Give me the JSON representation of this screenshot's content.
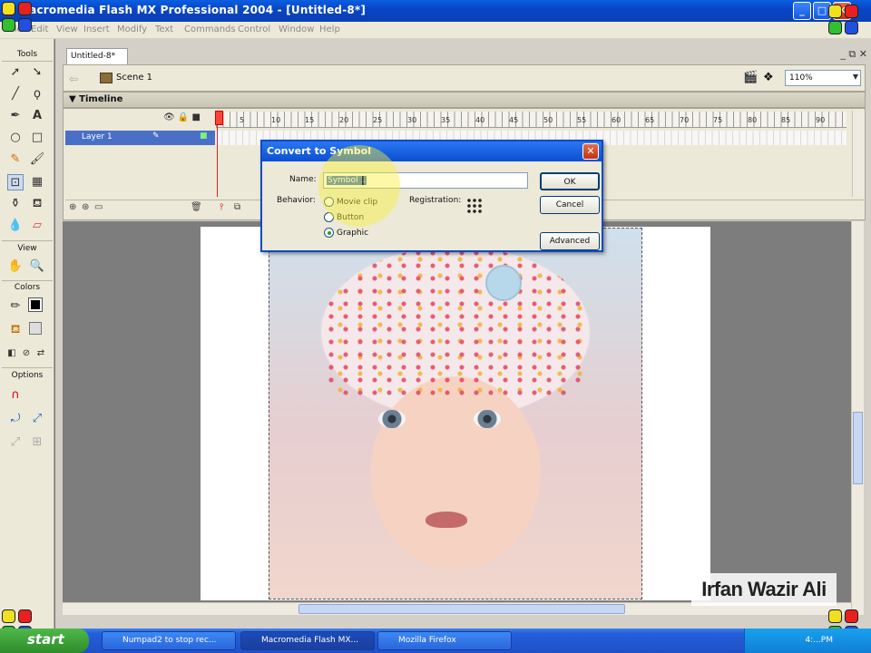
{
  "window": {
    "title": "Macromedia Flash MX Professional 2004 - [Untitled-8*]",
    "min_label": "_",
    "max_label": "□",
    "close_label": "✕"
  },
  "menu": [
    "File",
    "Edit",
    "View",
    "Insert",
    "Modify",
    "Text",
    "Commands",
    "Control",
    "Window",
    "Help"
  ],
  "tools_panel": {
    "header": "Tools",
    "view_header": "View",
    "colors_header": "Colors",
    "options_header": "Options"
  },
  "document": {
    "tab": "Untitled-8*",
    "scene": "Scene 1",
    "zoom": "110%",
    "doc_buttons": "_ ⧉ ✕"
  },
  "timeline": {
    "label": "Timeline",
    "layer_name": "Layer 1",
    "frame_numbers": [
      "1",
      "5",
      "10",
      "15",
      "20",
      "25",
      "30",
      "35",
      "40",
      "45",
      "50",
      "55",
      "60",
      "65",
      "70",
      "75",
      "80",
      "85",
      "90",
      "95"
    ]
  },
  "dialog": {
    "title": "Convert to Symbol",
    "name_label": "Name:",
    "name_value": "Symbol 1",
    "behavior_label": "Behavior:",
    "options": [
      "Movie clip",
      "Button",
      "Graphic"
    ],
    "selected_option": "Graphic",
    "registration_label": "Registration:",
    "ok_label": "OK",
    "cancel_label": "Cancel",
    "advanced_label": "Advanced",
    "close_label": "✕"
  },
  "watermark": "Irfan Wazir Ali",
  "taskbar": {
    "start_label": "start",
    "tasks": [
      {
        "label": "Numpad2 to stop rec...",
        "active": false
      },
      {
        "label": "Macromedia Flash MX...",
        "active": true
      },
      {
        "label": "Mozilla Firefox",
        "active": false
      }
    ],
    "clock": "4:...PM"
  },
  "colors": {
    "titlebar": "#0a4ac8",
    "selection": "#316ac5",
    "highlight": "#f5ec3c"
  }
}
